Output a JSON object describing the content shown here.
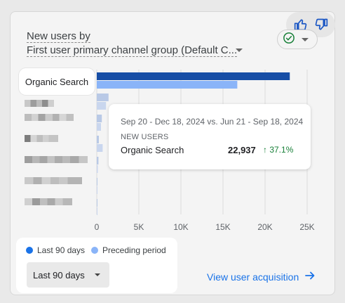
{
  "card": {
    "title": "New users by",
    "dimension": "First user primary channel group (Default C...",
    "feedback": {
      "thumbs_up_icon": "thumbs-up-icon",
      "thumbs_down_icon": "thumbs-down-icon"
    },
    "status_icon": "check-circle-icon"
  },
  "highlighted_label": "Organic Search",
  "tooltip": {
    "range": "Sep 20 - Dec 18, 2024 vs. Jun 21 - Sep 18, 2024",
    "metric": "NEW USERS",
    "row_label": "Organic Search",
    "row_value": "22,937",
    "row_change": "↑ 37.1%"
  },
  "legend": {
    "current": "Last 90 days",
    "previous": "Preceding period",
    "current_color": "#1a73e8",
    "previous_color": "#8ab4f8"
  },
  "date_range_select": "Last 90 days",
  "view_link": "View user acquisition",
  "chart_data": {
    "type": "bar",
    "orientation": "horizontal",
    "xlim": [
      0,
      25000
    ],
    "x_ticks": [
      "0",
      "5K",
      "10K",
      "15K",
      "20K",
      "25K"
    ],
    "categories": [
      "Organic Search",
      "",
      "",
      "",
      "",
      "",
      ""
    ],
    "series": [
      {
        "name": "Last 90 days",
        "values": [
          22937,
          1400,
          600,
          250,
          200,
          60,
          20
        ]
      },
      {
        "name": "Preceding period",
        "values": [
          16700,
          1100,
          500,
          700,
          120,
          80,
          30
        ]
      }
    ]
  }
}
